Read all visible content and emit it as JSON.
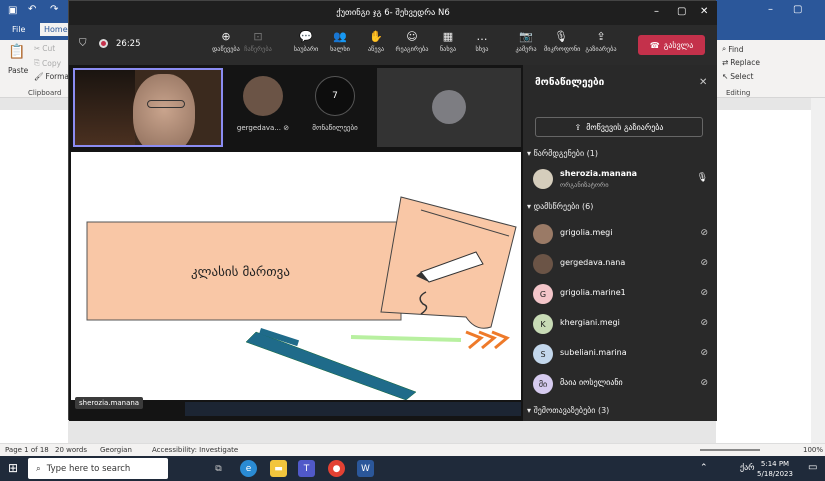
{
  "word": {
    "tabs": [
      "File",
      "Home"
    ],
    "clipboard": {
      "paste": "Paste",
      "cut": "Cut",
      "copy": "Copy",
      "format": "Format",
      "group": "Clipboard"
    },
    "editing": {
      "find": "Find",
      "replace": "Replace",
      "select": "Select",
      "group": "Editing"
    },
    "status": {
      "page": "Page 1 of 18",
      "words": "20 words",
      "language": "Georgian",
      "accessibility": "Accessibility: Investigate",
      "zoom": "100%"
    }
  },
  "taskbar": {
    "search_placeholder": "Type here to search",
    "lang": "ქარ",
    "time": "5:14 PM",
    "date": "5/18/2023"
  },
  "teams": {
    "title": "ქუთინგი ჯგ 6- შეხვედრა N6",
    "timer": "26:25",
    "toolbar": [
      {
        "label": "დაწევება",
        "icon": "⊕",
        "dim": false
      },
      {
        "label": "ჩაწერება",
        "icon": "⊡",
        "dim": true
      },
      {
        "label": "საუბარი",
        "icon": "💬",
        "dim": false
      },
      {
        "label": "ხალხი",
        "icon": "👥",
        "dim": false
      },
      {
        "label": "აწევა",
        "icon": "✋",
        "dim": false
      },
      {
        "label": "რეაგირება",
        "icon": "☺",
        "dim": false
      },
      {
        "label": "ნახვა",
        "icon": "▦",
        "dim": false
      },
      {
        "label": "სხვა",
        "icon": "…",
        "dim": false
      },
      {
        "label": "კამერა",
        "icon": "📷",
        "dim": false
      },
      {
        "label": "მიკროფონი",
        "icon": "🎙",
        "dim": false
      },
      {
        "label": "გაზიარება",
        "icon": "⇪",
        "dim": false
      }
    ],
    "leave_label": "გასვლა",
    "tiles": [
      {
        "name": "gergedava...",
        "type": "photo"
      },
      {
        "name": "მონაწილეები",
        "type": "count",
        "count": "7"
      }
    ],
    "slide_text": "კლასის მართვა",
    "sharing_name": "sherozia.manana",
    "panel": {
      "title": "მონაწილეები",
      "share_invite": "მოწვევის გაზიარება",
      "organizers_header": "წარმდგენები (1)",
      "organizer": {
        "name": "sherozia.manana",
        "role": "ორგანიზატორი"
      },
      "attendees_header": "დამსწრეები (6)",
      "attendees": [
        {
          "name": "grigolia.megi",
          "initial": "",
          "color": "#9a7a66"
        },
        {
          "name": "gergedava.nana",
          "initial": "",
          "color": "#6b5446"
        },
        {
          "name": "grigolia.marine1",
          "initial": "G",
          "color": "#f3c5c9"
        },
        {
          "name": "khergiani.megi",
          "initial": "K",
          "color": "#c8dbb6"
        },
        {
          "name": "subeliani.marina",
          "initial": "S",
          "color": "#c3d7ec"
        },
        {
          "name": "მაია იოსელიანი",
          "initial": "მი",
          "color": "#d6cbef"
        }
      ],
      "others_header": "შემოთავაზებები (3)"
    }
  }
}
